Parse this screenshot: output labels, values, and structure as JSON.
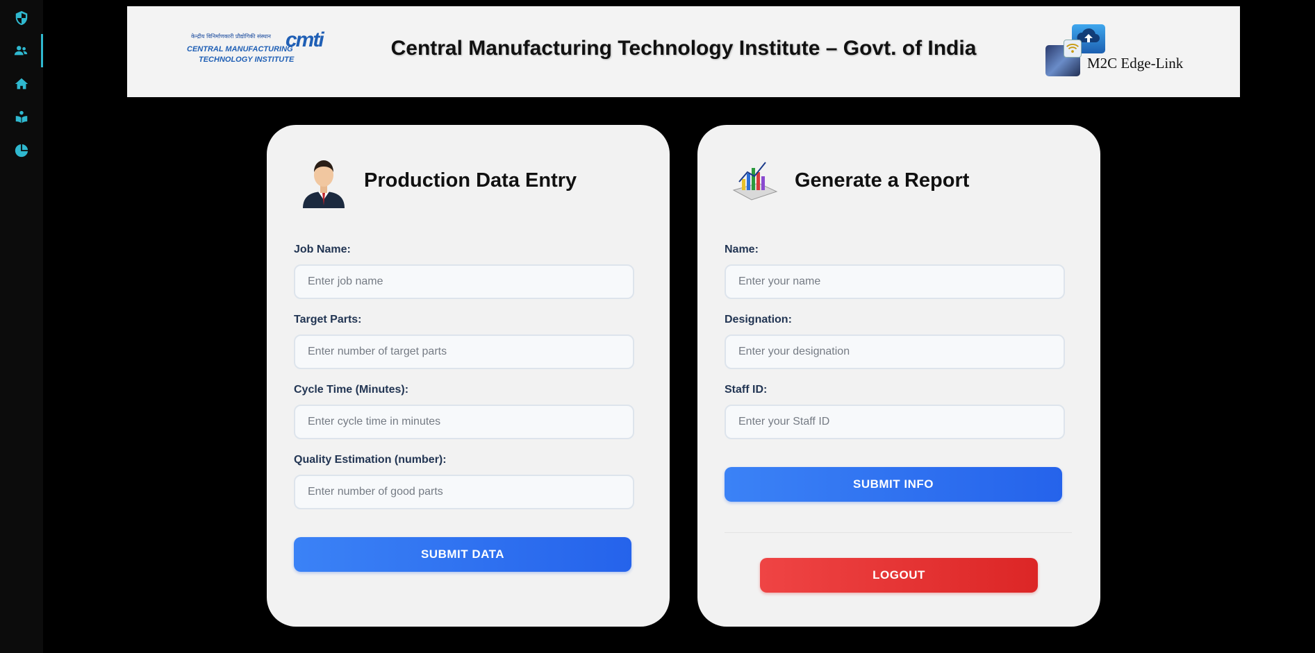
{
  "sidebar": {
    "items": [
      {
        "icon": "shield-icon",
        "active": false
      },
      {
        "icon": "users-icon",
        "active": true
      },
      {
        "icon": "home-icon",
        "active": false
      },
      {
        "icon": "book-reader-icon",
        "active": false
      },
      {
        "icon": "pie-chart-icon",
        "active": false
      }
    ]
  },
  "header": {
    "title": "Central Manufacturing Technology Institute – Govt. of India",
    "logo_left": {
      "hindi": "केन्द्रीय विनिर्माणकारी प्रौद्योगिकी संस्थान",
      "mark": "cmti",
      "line1": "CENTRAL MANUFACTURING",
      "line2": "TECHNOLOGY INSTITUTE"
    },
    "logo_right": {
      "text": "M2C Edge-Link"
    }
  },
  "production_card": {
    "title": "Production Data Entry",
    "fields": [
      {
        "label": "Job Name:",
        "placeholder": "Enter job name"
      },
      {
        "label": "Target Parts:",
        "placeholder": "Enter number of target parts"
      },
      {
        "label": "Cycle Time (Minutes):",
        "placeholder": "Enter cycle time in minutes"
      },
      {
        "label": "Quality Estimation (number):",
        "placeholder": "Enter number of good parts"
      }
    ],
    "submit_label": "SUBMIT DATA"
  },
  "report_card": {
    "title": "Generate a Report",
    "fields": [
      {
        "label": "Name:",
        "placeholder": "Enter your name"
      },
      {
        "label": "Designation:",
        "placeholder": "Enter your designation"
      },
      {
        "label": "Staff ID:",
        "placeholder": "Enter your Staff ID"
      }
    ],
    "submit_label": "SUBMIT INFO",
    "logout_label": "LOGOUT"
  },
  "colors": {
    "accent": "#2fb8cf",
    "primary_button": "#3b82f6",
    "danger_button": "#ef4444",
    "card_bg": "#f2f2f2",
    "page_bg": "#000000"
  }
}
